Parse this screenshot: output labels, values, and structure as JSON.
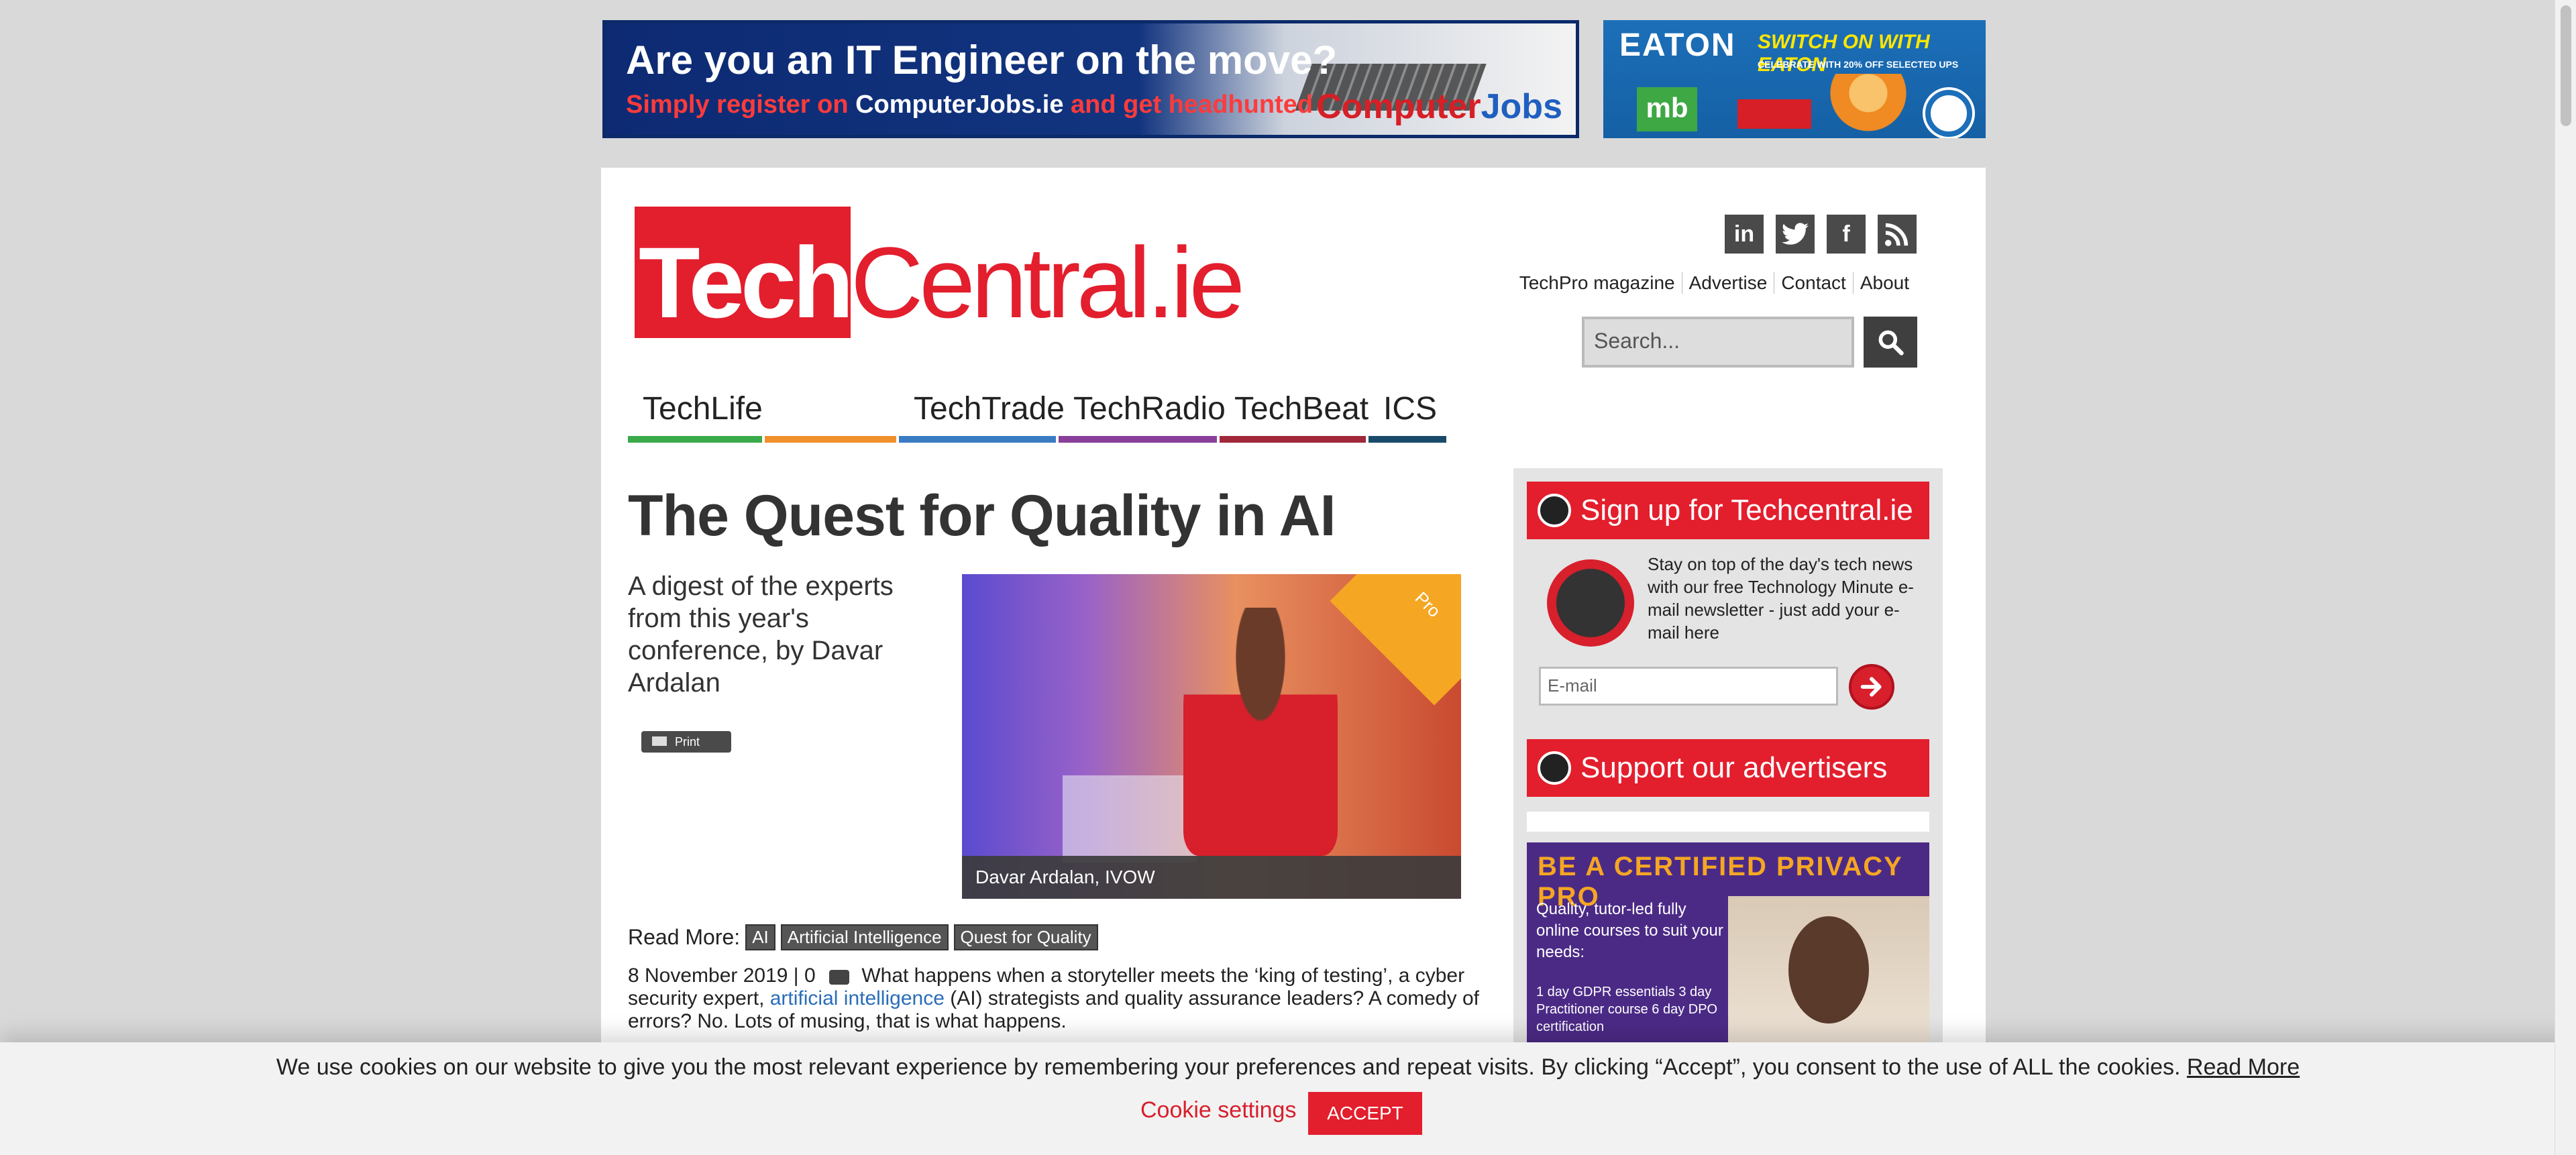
{
  "ads": {
    "top_left": {
      "line1": "Are you an IT Engineer on the move?",
      "line2_a": "Simply register on ",
      "line2_b": "ComputerJobs.ie",
      "line2_c": " and get headhunted",
      "brand_a": "Computer",
      "brand_b": "Jobs"
    },
    "top_right": {
      "brand": "EATON",
      "headline": "SWITCH ON WITH EATON",
      "sub": "CELEBRATE WITH 20% OFF SELECTED UPS",
      "mb": "mb"
    },
    "sidebar": {
      "headline": "BE A CERTIFIED PRIVACY PRO",
      "body": "Quality, tutor-led fully online courses to suit your needs:",
      "list": "1 day GDPR essentials 3 day Practitioner course 6 day DPO certification"
    }
  },
  "header": {
    "logo_tech": "Tech",
    "logo_central": "Central.ie",
    "social": [
      "in",
      "t",
      "f",
      "rss"
    ],
    "links": [
      "TechPro magazine",
      "Advertise",
      "Contact",
      "About"
    ],
    "search_placeholder": "Search..."
  },
  "nav": [
    {
      "label": "TechLife",
      "color": "#3aaa4a"
    },
    {
      "label": "",
      "color": "#f0902c"
    },
    {
      "label": "TechTrade",
      "color": "#3a7cc2"
    },
    {
      "label": "TechRadio",
      "color": "#8a3f9a"
    },
    {
      "label": "TechBeat",
      "color": "#a0283a"
    },
    {
      "label": "ICS",
      "color": "#1a4a6a"
    }
  ],
  "article": {
    "title": "The Quest for Quality in AI",
    "subtitle": "A digest of the experts from this year's conference, by Davar Ardalan",
    "print_label": "Print",
    "image_caption": "Davar Ardalan, IVOW",
    "badge": "Pro",
    "read_more_label": "Read More:",
    "tags": [
      "AI",
      "Artificial Intelligence",
      "Quest for Quality"
    ],
    "date": "8 November 2019 | 0",
    "lead_a": "What happens when a storyteller meets the ‘king of testing’, a cyber security expert, ",
    "lead_link": "artificial intelligence",
    "lead_b": " (AI) strategists and quality assurance leaders? A comedy of errors? No. Lots of musing, that is what happens."
  },
  "sidebar": {
    "signup_title": "Sign up for Techcentral.ie",
    "signup_text": "Stay on top of the day's tech news with our free Technology Minute e-mail newsletter - just add your e-mail here",
    "email_placeholder": "E-mail",
    "advertisers_title": "Support our advertisers"
  },
  "cookie": {
    "message": "We use cookies on our website to give you the most relevant experience by remembering your preferences and repeat visits. By clicking “Accept”, you consent to the use of ALL the cookies.",
    "read_more": "Read More",
    "settings": "Cookie settings",
    "accept": "ACCEPT"
  }
}
